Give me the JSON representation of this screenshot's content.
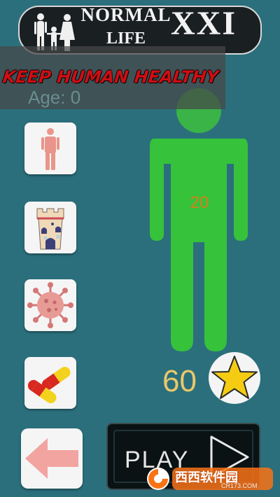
{
  "header": {
    "title_line1": "NORMAL",
    "title_line2": "LIFE",
    "title_suffix": "XXI"
  },
  "banner": {
    "tagline": "KEEP HUMAN HEALTHY",
    "age_text": "Age: 0"
  },
  "menu": {
    "items": [
      {
        "icon": "person-icon"
      },
      {
        "icon": "castle-icon"
      },
      {
        "icon": "virus-icon"
      },
      {
        "icon": "pill-icon"
      }
    ],
    "back_icon": "back-arrow-icon"
  },
  "human": {
    "health_value": "20",
    "color": "#36c23b",
    "head_color": "#3ab347"
  },
  "stars": {
    "count": "60",
    "star_color": "#f5cc12"
  },
  "play": {
    "label": "PLAY",
    "icon": "play-triangle-icon"
  },
  "watermark": {
    "text": "西西软件园",
    "sub": "CR173.COM"
  },
  "colors": {
    "background": "#2b6f7c",
    "banner_text": "#cc0f14"
  }
}
